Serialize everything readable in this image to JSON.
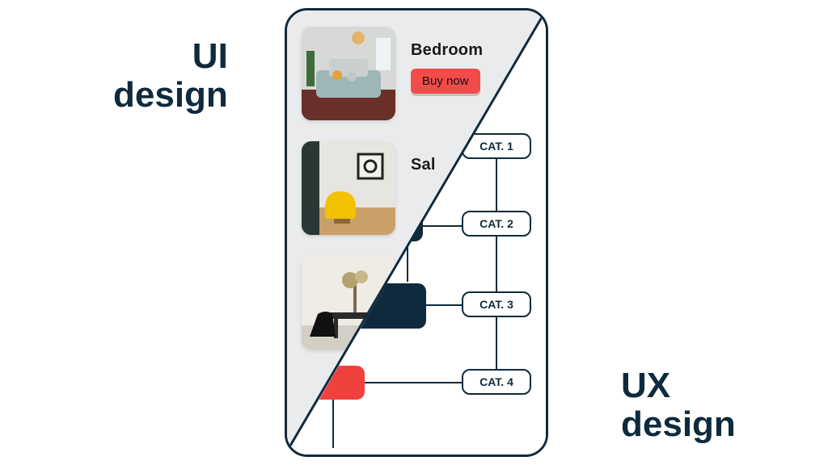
{
  "labels": {
    "ui_line1": "UI",
    "ui_line2": "design",
    "ux_line1": "UX",
    "ux_line2": "design"
  },
  "ui_side": {
    "cards": [
      {
        "title": "Bedroom",
        "cta": "Buy now",
        "thumb": "bedroom"
      },
      {
        "title": "Sal",
        "cta": "",
        "thumb": "living"
      },
      {
        "title": "",
        "cta": "",
        "thumb": "dining"
      }
    ]
  },
  "ux_side": {
    "categories": [
      {
        "label": "CAT. 1"
      },
      {
        "label": "CAT. 2"
      },
      {
        "label": "CAT. 3"
      },
      {
        "label": "CAT. 4"
      }
    ]
  },
  "palette": {
    "ink": "#0f2a3d",
    "accent": "#f14c4a",
    "greybg": "#eaebec"
  }
}
